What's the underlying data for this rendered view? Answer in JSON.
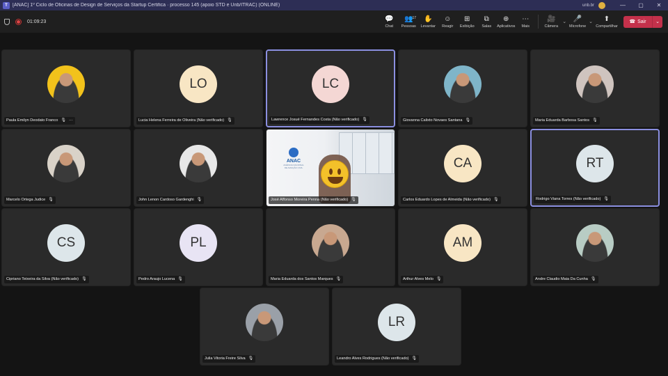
{
  "window": {
    "title": "[ANAC] 1º Ciclo de Oficinas de Design de Serviços da Startup Certifica · processo 145 (apoio STD e Unb/ITRAC) (ONLINE)",
    "user": "unb.br",
    "minimize": "—",
    "maximize": "▢",
    "close": "✕"
  },
  "toolbar": {
    "timer": "01:09:23",
    "buttons": [
      {
        "label": "Chat",
        "icon": "chat-icon",
        "glyph": "💬"
      },
      {
        "label": "Pessoas",
        "icon": "people-icon",
        "glyph": "👥",
        "badge": "17"
      },
      {
        "label": "Levantar",
        "icon": "raise-hand-icon",
        "glyph": "✋"
      },
      {
        "label": "Reagir",
        "icon": "react-icon",
        "glyph": "☺"
      },
      {
        "label": "Exibição",
        "icon": "view-icon",
        "glyph": "⊞"
      },
      {
        "label": "Salas",
        "icon": "rooms-icon",
        "glyph": "⧉"
      },
      {
        "label": "Aplicativos",
        "icon": "apps-icon",
        "glyph": "⊕"
      },
      {
        "label": "Mais",
        "icon": "more-icon",
        "glyph": "⋯"
      }
    ],
    "camera": {
      "label": "Câmera",
      "glyph": "🎥"
    },
    "microphone": {
      "label": "Microfone",
      "glyph": "🎤"
    },
    "share": {
      "label": "Compartilhar",
      "glyph": "⬆"
    },
    "leave": {
      "label": "Sair",
      "glyph": "☎"
    }
  },
  "participants": [
    {
      "name": "Paula Emilyn Deodato Franco",
      "initials": "",
      "photo": true,
      "photo_color": "#f2c21b",
      "more": "···"
    },
    {
      "name": "Lucia Helena Ferreira de Oliveira (Não verificado)",
      "initials": "LO",
      "avatar_color": "#f8e6c4"
    },
    {
      "name": "Lawrence Josué Fernandes Costa (Não verificado)",
      "initials": "LC",
      "avatar_color": "#f4d7d4",
      "active": true
    },
    {
      "name": "Giovanna Calixto Novaes Santana",
      "initials": "",
      "photo": true,
      "photo_color": "#7fb5c9"
    },
    {
      "name": "Maria Eduarda Barbosa Santos",
      "initials": "",
      "photo": true,
      "photo_color": "#cfc4bf"
    },
    {
      "name": "Marcelo Ortega Judice",
      "initials": "",
      "photo": true,
      "photo_color": "#d9d2c8"
    },
    {
      "name": "John Lenon Cardoso Gardenghi",
      "initials": "",
      "photo": true,
      "photo_color": "#e8e8e8"
    },
    {
      "name": "José Affonso Moreira Penna (Não verificado)",
      "video": true,
      "video_logo": "ANAC",
      "video_logo_sub": "AGÊNCIA NACIONAL DE AVIAÇÃO CIVIL"
    },
    {
      "name": "Carlos Eduardo Lopes de Almeida (Não verificado)",
      "initials": "CA",
      "avatar_color": "#f8e6c4"
    },
    {
      "name": "Rodrigo Viana Torres (Não verificado)",
      "initials": "RT",
      "avatar_color": "#dde6ea",
      "active": true
    },
    {
      "name": "Cipriano Teixeira da Silva (Não verificado)",
      "initials": "CS",
      "avatar_color": "#dde6ea"
    },
    {
      "name": "Pedro Araujo Lucena",
      "initials": "PL",
      "avatar_color": "#e8e4f4"
    },
    {
      "name": "Maria Eduarda dos Santos Marques",
      "initials": "",
      "photo": true,
      "photo_color": "#c8a890"
    },
    {
      "name": "Arthur Alves Melo",
      "initials": "AM",
      "avatar_color": "#f8e6c4"
    },
    {
      "name": "Andre Claudio Maia Da Cunha",
      "initials": "",
      "photo": true,
      "photo_color": "#b8ccc4"
    },
    {
      "name": "Julia Vitoria Freire Silva",
      "initials": "",
      "photo": true,
      "photo_color": "#9aa0a8"
    },
    {
      "name": "Leandro Alves Rodrigues (Não verificado)",
      "initials": "LR",
      "avatar_color": "#dde6ea"
    }
  ]
}
